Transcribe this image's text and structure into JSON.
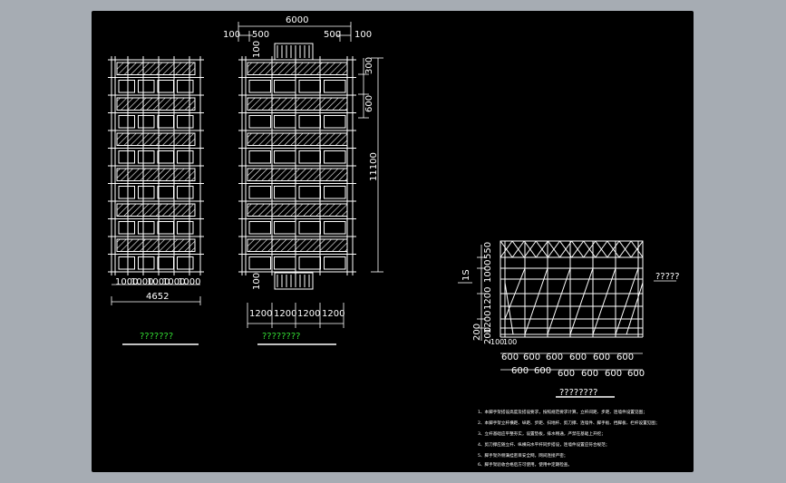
{
  "plan_left": {
    "dims_bottom": [
      "1000",
      "1000",
      "1000",
      "1000",
      "1000"
    ],
    "total_width": "4652",
    "title": "???????"
  },
  "plan_right": {
    "top_total": "6000",
    "top_dims": [
      "100",
      "500",
      "500",
      "100"
    ],
    "side_top": "300",
    "side_mid": "600",
    "side_total": "11100",
    "left_top": "100",
    "left_bottom": "100",
    "bottom_dims": [
      "1200",
      "1200",
      "1200",
      "1200"
    ],
    "title": "????????"
  },
  "section": {
    "left_dims": [
      "550",
      "1000",
      "1200",
      "1200",
      "200",
      "200"
    ],
    "left_small": "1S",
    "side_label": "?????",
    "bottom_row1": [
      "600",
      "600",
      "600",
      "600",
      "600",
      "600"
    ],
    "bottom_row2": [
      "600",
      "600",
      "600",
      "600",
      "600",
      "600"
    ],
    "bottom_small": [
      "100",
      "100"
    ],
    "title": "????????"
  },
  "notes": [
    "1、本脚手架搭设高度及搭设要求，按照规范要求计算，立杆间距、步距、连墙件设置见图；",
    "2、本脚手架立杆横距、纵距、步距、扫地杆、剪刀撑、连墙件、脚手板、挡脚板、栏杆设置见图；",
    "3、立杆基础应平整夯实，设置垫板，排水畅通，严禁在基础上开挖；",
    "4、剪刀撑应随立杆、纵横向水平杆同步搭设，连墙件设置应符合规范；",
    "5、脚手架外侧满挂密目安全网，网间连接严密；",
    "6、脚手架验收合格后方可使用，使用中定期检查。"
  ]
}
